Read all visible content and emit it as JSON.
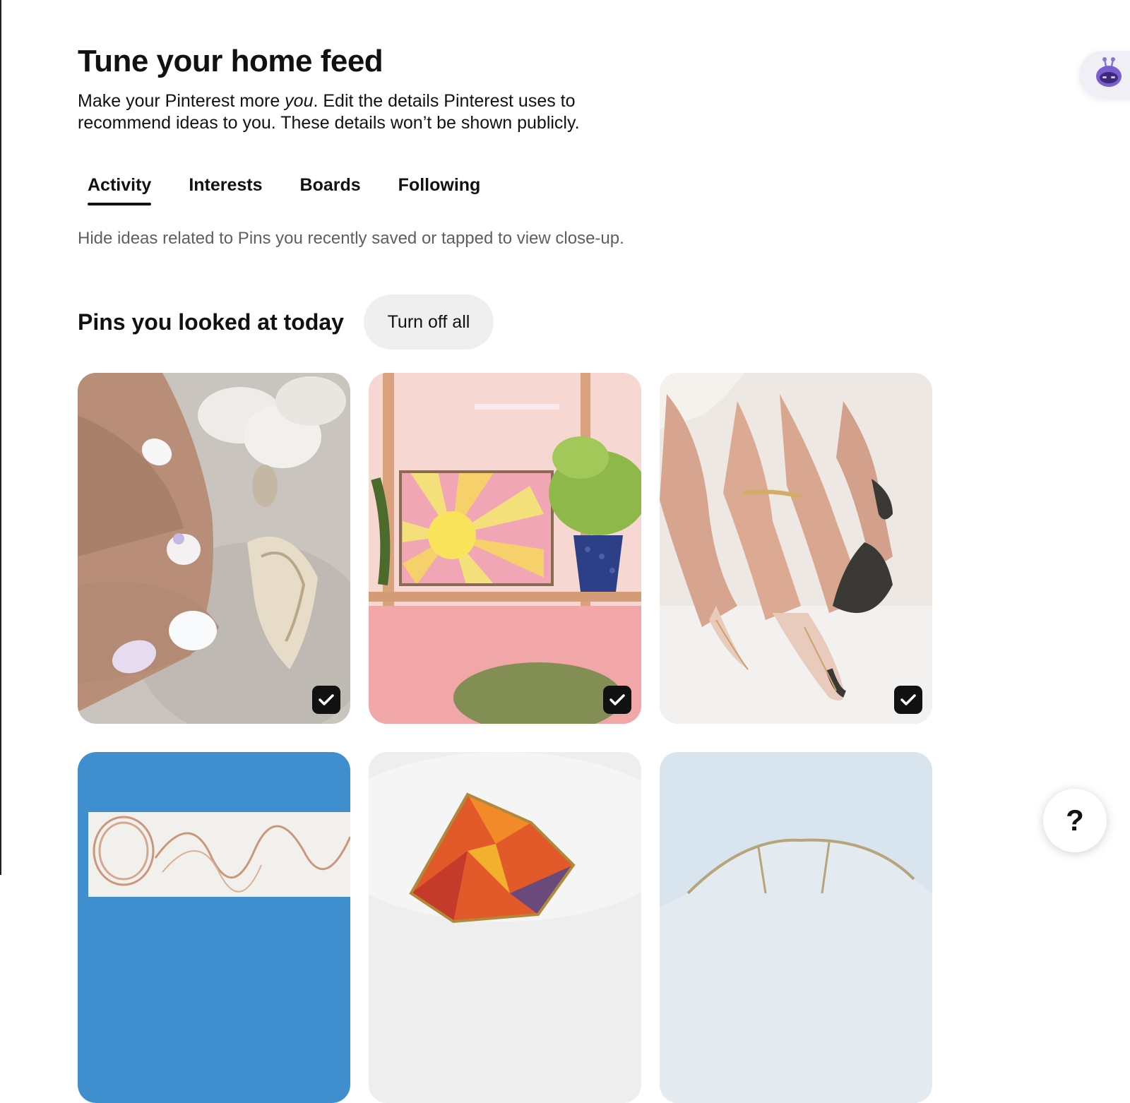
{
  "header": {
    "title": "Tune your home feed",
    "intro_before": "Make your Pinterest more ",
    "intro_emphasis": "you",
    "intro_after": ". Edit the details Pinterest uses to recommend ideas to you. These details won’t be shown publicly."
  },
  "tabs": [
    {
      "label": "Activity",
      "active": true
    },
    {
      "label": "Interests",
      "active": false
    },
    {
      "label": "Boards",
      "active": false
    },
    {
      "label": "Following",
      "active": false
    }
  ],
  "section": {
    "description": "Hide ideas related to Pins you recently saved or tapped to view close-up.",
    "title": "Pins you looked at today",
    "turn_off_label": "Turn off all"
  },
  "pins": [
    {
      "subject": "white manicure with seashells on sand",
      "selected": true
    },
    {
      "subject": "stained glass sun panel on shelf with plants",
      "selected": true
    },
    {
      "subject": "nude and black almond nails with gold ring",
      "selected": true
    },
    {
      "subject": "copper ribbon on blue background",
      "selected": null
    },
    {
      "subject": "stained glass leaf on white fur",
      "selected": null
    },
    {
      "subject": "clear glass piece on pale blue",
      "selected": null
    }
  ],
  "icons": {
    "check": "checkmark-icon",
    "assistant": "robot-assistant-icon",
    "help": "question-mark-icon"
  },
  "help": {
    "label": "?"
  },
  "colors": {
    "tab_underline": "#111111",
    "button_bg": "#efefef",
    "checkbox_bg": "#111111",
    "muted_text": "#5f5f5f"
  }
}
